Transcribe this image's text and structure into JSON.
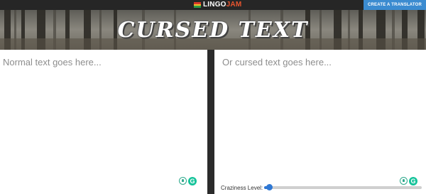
{
  "header": {
    "logo_part1": "LINGO",
    "logo_part2": "JAM",
    "cta_label": "CREATE A TRANSLATOR"
  },
  "banner": {
    "title": "CURSED TEXT"
  },
  "input_panel": {
    "placeholder": "Normal text goes here..."
  },
  "output_panel": {
    "placeholder": "Or cursed text goes here..."
  },
  "controls": {
    "craziness_label": "Craziness Level:",
    "craziness_value": 0.03
  },
  "extensions": {
    "icons": [
      "bulb-icon",
      "grammarly-icon"
    ],
    "grammarly_letter": "G"
  },
  "colors": {
    "accent": "#3b8bd0",
    "logo_accent": "#e8552f",
    "slider": "#2f78d4",
    "grammarly": "#15c39a"
  }
}
